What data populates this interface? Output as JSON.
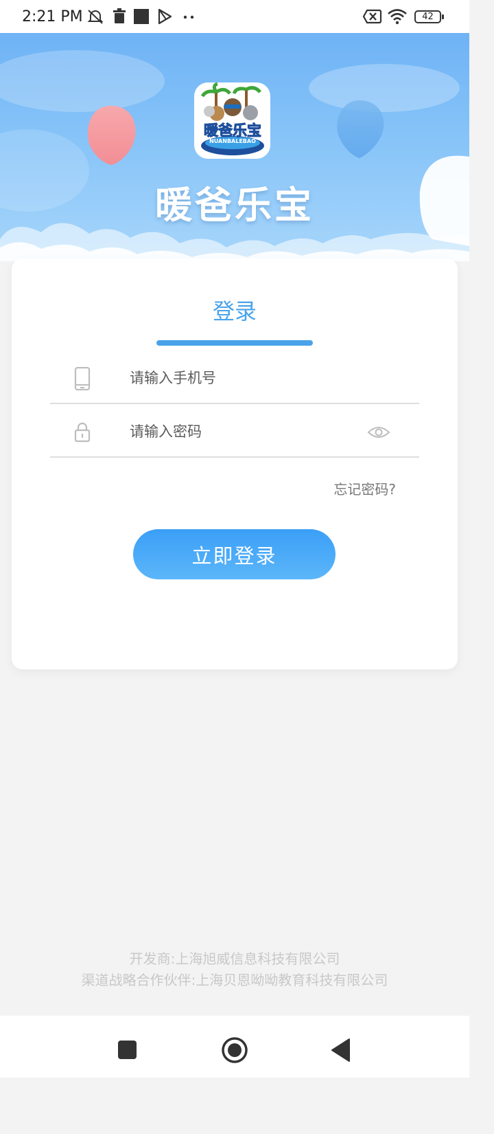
{
  "status_bar": {
    "time": "2:21 PM",
    "battery": "42",
    "icons": [
      "mute-icon",
      "trash-icon",
      "square-icon",
      "play-store-icon",
      "more-dots-icon",
      "no-sim-icon",
      "wifi-icon",
      "battery-icon"
    ]
  },
  "hero": {
    "app_name": "暖爸乐宝",
    "logo_text": "暖爸乐宝",
    "logo_subtext": "NUANBALEBAO"
  },
  "login": {
    "title": "登录",
    "phone_placeholder": "请输入手机号",
    "password_placeholder": "请输入密码",
    "forgot_password": "忘记密码?",
    "submit_label": "立即登录"
  },
  "footer": {
    "developer": "开发商:上海旭威信息科技有限公司",
    "partner": "渠道战略合作伙伴:上海贝恩呦呦教育科技有限公司"
  },
  "colors": {
    "accent": "#4aa3ea",
    "button": "#3b9ff7",
    "background": "#f3f3f4"
  }
}
